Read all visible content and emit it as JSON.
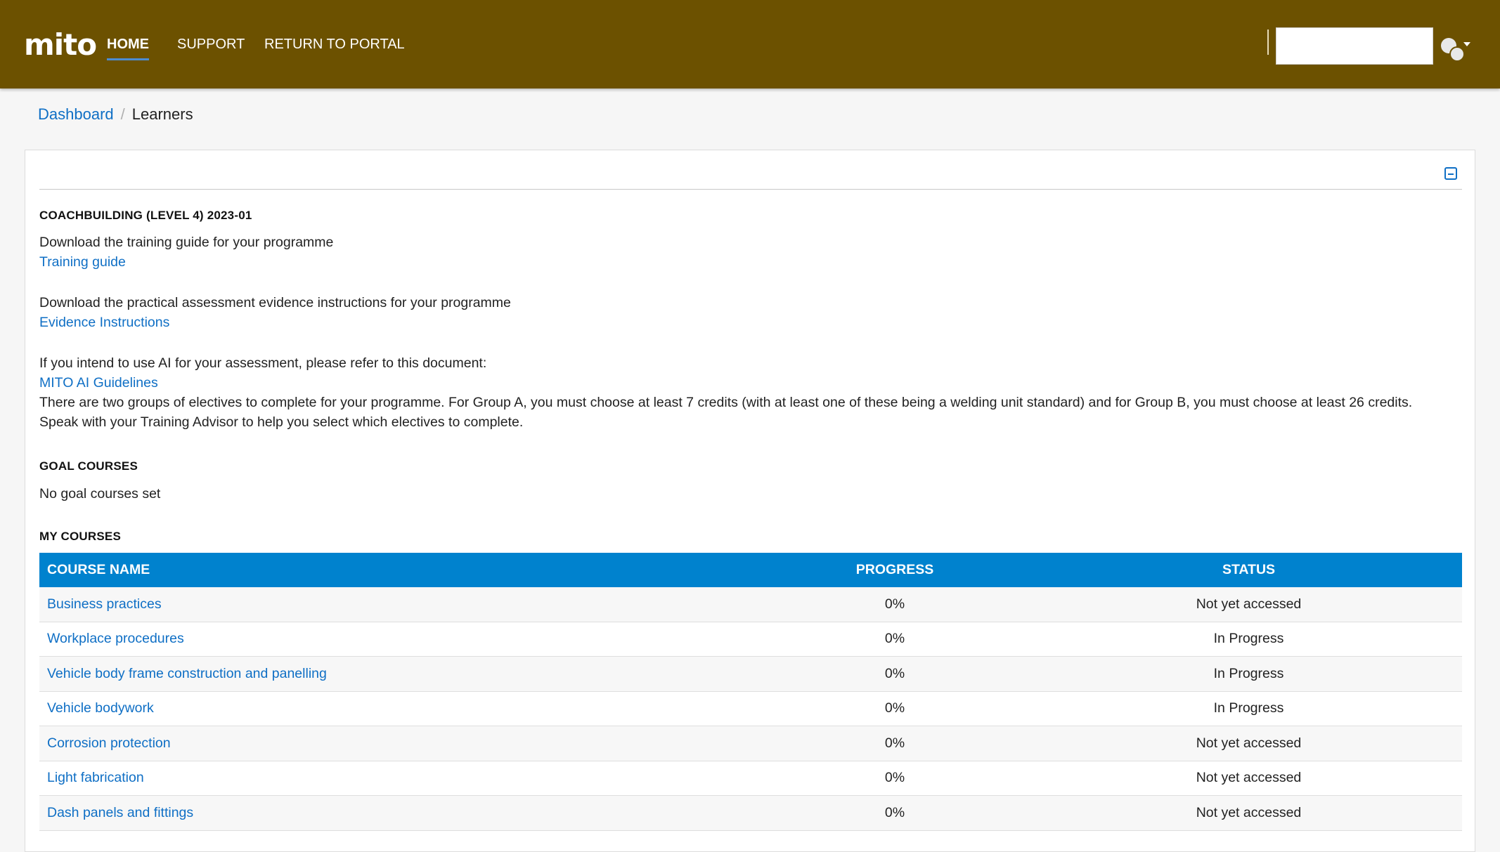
{
  "nav": {
    "logo": "mito",
    "items": [
      {
        "label": "HOME",
        "active": true
      },
      {
        "label": "SUPPORT",
        "active": false
      },
      {
        "label": "RETURN TO PORTAL",
        "active": false
      }
    ],
    "search_value": "",
    "icons": {
      "user": "user-avatar-icon",
      "caret": "caret-down-icon"
    },
    "colors": {
      "navbar": "#6c5100",
      "link": "#0f6fc5",
      "table_header": "#0082ce"
    }
  },
  "breadcrumb": {
    "parent": "Dashboard",
    "separator": "/",
    "current": "Learners"
  },
  "card": {
    "collapse_icon": "minus-square-icon",
    "programme_title": "COACHBUILDING (LEVEL 4) 2023-01",
    "training_guide_text": "Download the training guide for your programme",
    "training_guide_link": "Training guide",
    "evidence_text": "Download the practical assessment evidence instructions for your programme",
    "evidence_link": "Evidence Instructions",
    "ai_text": "If you intend to use AI for your assessment, please refer to this document:",
    "ai_link": "MITO AI Guidelines",
    "electives_line1": "There are two groups of electives to complete for your programme. For Group A, you must choose at least 7 credits (with at least one of these being a welding unit standard) and for Group B, you must choose at least 26 credits.",
    "electives_line2": "Speak with your Training Advisor to help you select which electives to complete.",
    "goal_title": "GOAL COURSES",
    "goal_text": "No goal courses set",
    "my_courses_title": "MY COURSES"
  },
  "courses": {
    "headers": [
      "COURSE NAME",
      "PROGRESS",
      "STATUS"
    ],
    "rows": [
      {
        "name": "Business practices",
        "progress": "0%",
        "status": "Not yet accessed"
      },
      {
        "name": "Workplace procedures",
        "progress": "0%",
        "status": "In Progress"
      },
      {
        "name": "Vehicle body frame construction and panelling",
        "progress": "0%",
        "status": "In Progress"
      },
      {
        "name": "Vehicle bodywork",
        "progress": "0%",
        "status": "In Progress"
      },
      {
        "name": "Corrosion protection",
        "progress": "0%",
        "status": "Not yet accessed"
      },
      {
        "name": "Light fabrication",
        "progress": "0%",
        "status": "Not yet accessed"
      },
      {
        "name": "Dash panels and fittings",
        "progress": "0%",
        "status": "Not yet accessed"
      }
    ]
  }
}
